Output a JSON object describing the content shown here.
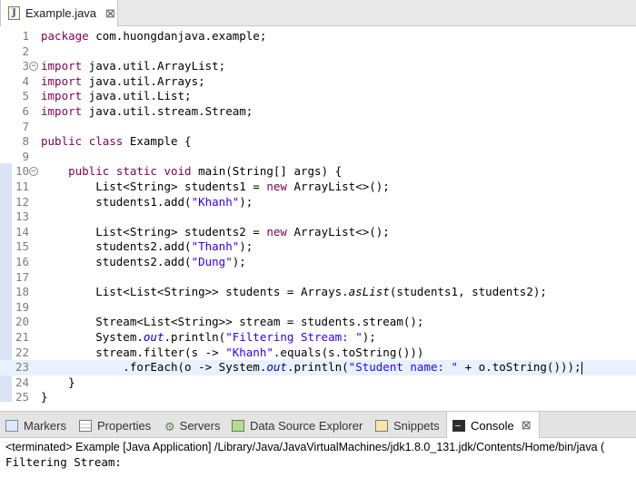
{
  "editor_tab": {
    "title": "Example.java",
    "icon": "java-file-icon",
    "icon_glyph": "J",
    "close_glyph": "⊠"
  },
  "code_lines": [
    {
      "num": "1",
      "fold": "",
      "segments": [
        {
          "t": "package",
          "c": "kw"
        },
        {
          "t": " com.huongdanjava.example;",
          "c": ""
        }
      ]
    },
    {
      "num": "2",
      "fold": "",
      "segments": []
    },
    {
      "num": "3",
      "fold": "−",
      "segments": [
        {
          "t": "import",
          "c": "kw"
        },
        {
          "t": " java.util.ArrayList;",
          "c": ""
        }
      ]
    },
    {
      "num": "4",
      "fold": "",
      "segments": [
        {
          "t": "import",
          "c": "kw"
        },
        {
          "t": " java.util.Arrays;",
          "c": ""
        }
      ]
    },
    {
      "num": "5",
      "fold": "",
      "segments": [
        {
          "t": "import",
          "c": "kw"
        },
        {
          "t": " java.util.List;",
          "c": ""
        }
      ]
    },
    {
      "num": "6",
      "fold": "",
      "segments": [
        {
          "t": "import",
          "c": "kw"
        },
        {
          "t": " java.util.stream.Stream;",
          "c": ""
        }
      ]
    },
    {
      "num": "7",
      "fold": "",
      "segments": []
    },
    {
      "num": "8",
      "fold": "",
      "segments": [
        {
          "t": "public",
          "c": "kw"
        },
        {
          "t": " ",
          "c": ""
        },
        {
          "t": "class",
          "c": "kw"
        },
        {
          "t": " Example {",
          "c": ""
        }
      ]
    },
    {
      "num": "9",
      "fold": "",
      "segments": []
    },
    {
      "num": "10",
      "fold": "−",
      "segments": [
        {
          "t": "    ",
          "c": ""
        },
        {
          "t": "public",
          "c": "kw"
        },
        {
          "t": " ",
          "c": ""
        },
        {
          "t": "static",
          "c": "kw"
        },
        {
          "t": " ",
          "c": ""
        },
        {
          "t": "void",
          "c": "kw"
        },
        {
          "t": " main(String[] args) {",
          "c": ""
        }
      ]
    },
    {
      "num": "11",
      "fold": "",
      "segments": [
        {
          "t": "        List<String> students1 = ",
          "c": ""
        },
        {
          "t": "new",
          "c": "kw"
        },
        {
          "t": " ArrayList<>();",
          "c": ""
        }
      ]
    },
    {
      "num": "12",
      "fold": "",
      "segments": [
        {
          "t": "        students1.add(",
          "c": ""
        },
        {
          "t": "\"Khanh\"",
          "c": "str"
        },
        {
          "t": ");",
          "c": ""
        }
      ]
    },
    {
      "num": "13",
      "fold": "",
      "segments": []
    },
    {
      "num": "14",
      "fold": "",
      "segments": [
        {
          "t": "        List<String> students2 = ",
          "c": ""
        },
        {
          "t": "new",
          "c": "kw"
        },
        {
          "t": " ArrayList<>();",
          "c": ""
        }
      ]
    },
    {
      "num": "15",
      "fold": "",
      "segments": [
        {
          "t": "        students2.add(",
          "c": ""
        },
        {
          "t": "\"Thanh\"",
          "c": "str"
        },
        {
          "t": ");",
          "c": ""
        }
      ]
    },
    {
      "num": "16",
      "fold": "",
      "segments": [
        {
          "t": "        students2.add(",
          "c": ""
        },
        {
          "t": "\"Dung\"",
          "c": "str"
        },
        {
          "t": ");",
          "c": ""
        }
      ]
    },
    {
      "num": "17",
      "fold": "",
      "segments": []
    },
    {
      "num": "18",
      "fold": "",
      "segments": [
        {
          "t": "        List<List<String>> students = Arrays.",
          "c": ""
        },
        {
          "t": "asList",
          "c": "stm"
        },
        {
          "t": "(students1, students2);",
          "c": ""
        }
      ]
    },
    {
      "num": "19",
      "fold": "",
      "segments": []
    },
    {
      "num": "20",
      "fold": "",
      "segments": [
        {
          "t": "        Stream<List<String>> stream = students.stream();",
          "c": ""
        }
      ]
    },
    {
      "num": "21",
      "fold": "",
      "segments": [
        {
          "t": "        System.",
          "c": ""
        },
        {
          "t": "out",
          "c": "fld"
        },
        {
          "t": ".println(",
          "c": ""
        },
        {
          "t": "\"Filtering Stream: \"",
          "c": "str"
        },
        {
          "t": ");",
          "c": ""
        }
      ]
    },
    {
      "num": "22",
      "fold": "",
      "segments": [
        {
          "t": "        stream.filter(s -> ",
          "c": ""
        },
        {
          "t": "\"Khanh\"",
          "c": "str"
        },
        {
          "t": ".equals(s.toString()))",
          "c": ""
        }
      ]
    },
    {
      "num": "23",
      "fold": "",
      "current": true,
      "segments": [
        {
          "t": "            .forEach(o -> System.",
          "c": ""
        },
        {
          "t": "out",
          "c": "fld"
        },
        {
          "t": ".println(",
          "c": ""
        },
        {
          "t": "\"Student name: \"",
          "c": "str"
        },
        {
          "t": " + o.toString()));",
          "c": ""
        }
      ]
    },
    {
      "num": "24",
      "fold": "",
      "segments": [
        {
          "t": "    }",
          "c": ""
        }
      ]
    },
    {
      "num": "25",
      "fold": "",
      "segments": [
        {
          "t": "}",
          "c": ""
        }
      ]
    }
  ],
  "views_tabs": [
    {
      "label": "Markers",
      "icon": "markers-icon",
      "name": "tab-markers"
    },
    {
      "label": "Properties",
      "icon": "properties-icon",
      "name": "tab-properties"
    },
    {
      "label": "Servers",
      "icon": "servers-icon",
      "name": "tab-servers"
    },
    {
      "label": "Data Source Explorer",
      "icon": "dse-icon",
      "name": "tab-data-source-explorer"
    },
    {
      "label": "Snippets",
      "icon": "snippets-icon",
      "name": "tab-snippets"
    },
    {
      "label": "Console",
      "icon": "console-icon",
      "name": "tab-console",
      "active": true
    }
  ],
  "console": {
    "description": "<terminated> Example [Java Application] /Library/Java/JavaVirtualMachines/jdk1.8.0_131.jdk/Contents/Home/bin/java (",
    "output": "Filtering Stream:"
  },
  "colors": {
    "keyword": "#7f0055",
    "string": "#2a00ff",
    "field": "#0000c0",
    "current_line": "#e8f2fe"
  }
}
